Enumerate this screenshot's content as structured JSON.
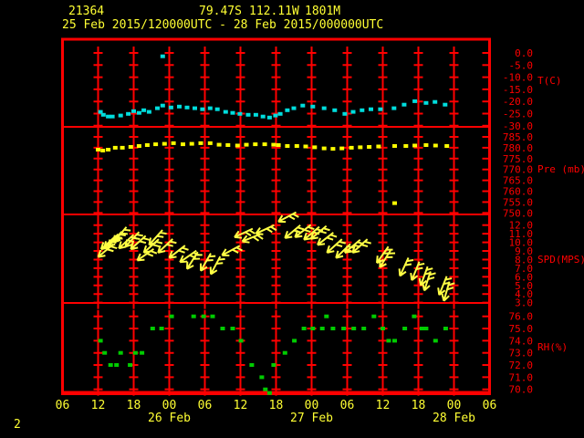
{
  "header": {
    "station_id": "21364",
    "latitude": "79.47S",
    "longitude": "112.11W",
    "elevation": "1801M",
    "period": "25 Feb 2015/120000UTC - 28 Feb 2015/000000UTC"
  },
  "page_indicator": "2",
  "colors": {
    "background": "#000000",
    "frame": "#ff0000",
    "grid": "#ff0000",
    "axis_text": "#ff0000",
    "header_text": "#ffff33",
    "time_text": "#ffff33",
    "temperature": "#00dddd",
    "pressure": "#ffff00",
    "wind": "#ffff44",
    "humidity": "#00cc00"
  },
  "x_axis": {
    "hours_span": 72,
    "label_step_hours": 6,
    "hour_labels": [
      "06",
      "12",
      "18",
      "00",
      "06",
      "12",
      "18",
      "00",
      "06",
      "12",
      "18",
      "00",
      "06"
    ],
    "date_labels": [
      {
        "label": "26 Feb",
        "hour": 18
      },
      {
        "label": "27 Feb",
        "hour": 42
      },
      {
        "label": "28 Feb",
        "hour": 66
      }
    ]
  },
  "chart_data": [
    {
      "type": "scatter",
      "name": "temperature",
      "unit_label": "T(C)",
      "ylim": [
        -30.5,
        5.6
      ],
      "tick_values": [
        0,
        -5,
        -10,
        -15,
        -20,
        -25,
        -30
      ],
      "tick_labels": [
        "0.0",
        "-5.0",
        "-10.0",
        "-15.0",
        "-20.0",
        "-25.0",
        "-30.0"
      ],
      "points": [
        [
          6.4,
          -24.3
        ],
        [
          6.9,
          -25.5
        ],
        [
          7.7,
          -26.2
        ],
        [
          8.4,
          -26.2
        ],
        [
          9.8,
          -25.8
        ],
        [
          11.1,
          -25.1
        ],
        [
          12.0,
          -24.0
        ],
        [
          12.9,
          -24.7
        ],
        [
          13.7,
          -23.6
        ],
        [
          14.6,
          -24.3
        ],
        [
          16.0,
          -22.8
        ],
        [
          16.9,
          -21.7
        ],
        [
          18.3,
          -22.5
        ],
        [
          19.7,
          -22.1
        ],
        [
          21.0,
          -22.5
        ],
        [
          22.3,
          -22.8
        ],
        [
          23.6,
          -23.2
        ],
        [
          24.9,
          -22.8
        ],
        [
          26.1,
          -23.2
        ],
        [
          27.5,
          -24.3
        ],
        [
          28.7,
          -24.7
        ],
        [
          29.9,
          -25.1
        ],
        [
          31.3,
          -25.5
        ],
        [
          32.6,
          -25.5
        ],
        [
          33.8,
          -26.2
        ],
        [
          34.9,
          -26.6
        ],
        [
          35.9,
          -25.8
        ],
        [
          36.7,
          -25.1
        ],
        [
          37.9,
          -23.6
        ],
        [
          39.0,
          -22.8
        ],
        [
          40.5,
          -21.7
        ],
        [
          42.2,
          -22.1
        ],
        [
          44.1,
          -22.8
        ],
        [
          45.9,
          -23.6
        ],
        [
          47.6,
          -25.1
        ],
        [
          49.0,
          -24.3
        ],
        [
          50.5,
          -23.6
        ],
        [
          52.0,
          -23.2
        ],
        [
          53.6,
          -23.2
        ],
        [
          55.9,
          -22.8
        ],
        [
          57.6,
          -21.3
        ],
        [
          59.4,
          -19.9
        ],
        [
          61.3,
          -20.6
        ],
        [
          62.8,
          -20.2
        ],
        [
          64.5,
          -21.3
        ]
      ],
      "outlier_points": [
        [
          16.9,
          -1.4
        ]
      ]
    },
    {
      "type": "scatter",
      "name": "pressure",
      "unit_label": "Pre (mb)",
      "ylim": [
        749.3,
        789.6
      ],
      "tick_values": [
        785,
        780,
        775,
        770,
        765,
        760,
        755,
        750
      ],
      "tick_labels": [
        "785.0",
        "780.0",
        "775.0",
        "770.0",
        "765.0",
        "760.0",
        "755.0",
        "750.0"
      ],
      "points": [
        [
          6.0,
          779.1
        ],
        [
          6.8,
          778.7
        ],
        [
          7.7,
          779.1
        ],
        [
          8.9,
          780.0
        ],
        [
          10.1,
          780.0
        ],
        [
          11.5,
          780.4
        ],
        [
          12.9,
          780.8
        ],
        [
          14.3,
          781.2
        ],
        [
          15.7,
          781.6
        ],
        [
          17.2,
          781.8
        ],
        [
          18.7,
          782.1
        ],
        [
          20.3,
          781.6
        ],
        [
          21.8,
          781.8
        ],
        [
          23.3,
          782.1
        ],
        [
          24.9,
          782.1
        ],
        [
          26.4,
          781.4
        ],
        [
          27.9,
          781.2
        ],
        [
          29.5,
          781.0
        ],
        [
          31.0,
          781.4
        ],
        [
          32.5,
          781.6
        ],
        [
          34.1,
          781.6
        ],
        [
          35.6,
          781.4
        ],
        [
          36.4,
          781.2
        ],
        [
          37.9,
          780.8
        ],
        [
          39.5,
          780.8
        ],
        [
          41.0,
          780.6
        ],
        [
          42.5,
          780.2
        ],
        [
          44.1,
          779.7
        ],
        [
          45.6,
          779.5
        ],
        [
          47.1,
          779.7
        ],
        [
          48.7,
          780.0
        ],
        [
          50.2,
          780.2
        ],
        [
          51.7,
          780.4
        ],
        [
          53.3,
          780.6
        ],
        [
          56.0,
          780.8
        ],
        [
          57.9,
          780.8
        ],
        [
          59.4,
          781.0
        ],
        [
          61.3,
          781.2
        ],
        [
          62.9,
          781.0
        ],
        [
          64.8,
          780.8
        ]
      ],
      "outlier_points": [
        [
          56.0,
          754.5
        ]
      ]
    },
    {
      "type": "arrow-scatter",
      "name": "wind_speed",
      "unit_label": "SPD(MPS)",
      "ylim": [
        2.9,
        13.2
      ],
      "tick_values": [
        12,
        11,
        10,
        9,
        8,
        7,
        6,
        5,
        4,
        3
      ],
      "tick_labels": [
        "12.0",
        "11.0",
        "10.0",
        "9.0",
        "8.0",
        "7.0",
        "6.0",
        "5.0",
        "4.0",
        "3.0"
      ],
      "points": [
        [
          6.0,
          8.3,
          140
        ],
        [
          6.5,
          9.2,
          138
        ],
        [
          7.0,
          9.3,
          135
        ],
        [
          7.7,
          9.5,
          132
        ],
        [
          8.6,
          10.0,
          130
        ],
        [
          9.5,
          9.3,
          137
        ],
        [
          10.6,
          9.5,
          133
        ],
        [
          11.5,
          9.2,
          138
        ],
        [
          12.6,
          7.9,
          145
        ],
        [
          13.7,
          8.8,
          138
        ],
        [
          14.6,
          9.7,
          132
        ],
        [
          16.1,
          8.8,
          137
        ],
        [
          18.0,
          8.2,
          142
        ],
        [
          19.8,
          7.7,
          145
        ],
        [
          21.0,
          6.9,
          122
        ],
        [
          23.3,
          6.7,
          120
        ],
        [
          25.0,
          6.3,
          118
        ],
        [
          26.9,
          8.5,
          152
        ],
        [
          29.0,
          10.6,
          155
        ],
        [
          30.3,
          10.1,
          158
        ],
        [
          32.6,
          11.0,
          155
        ],
        [
          36.4,
          12.4,
          152
        ],
        [
          37.5,
          10.5,
          140
        ],
        [
          39.2,
          10.6,
          142
        ],
        [
          40.7,
          10.3,
          140
        ],
        [
          41.9,
          10.4,
          140
        ],
        [
          43.0,
          9.7,
          142
        ],
        [
          44.6,
          8.8,
          138
        ],
        [
          46.1,
          8.2,
          136
        ],
        [
          47.6,
          8.8,
          140
        ],
        [
          48.9,
          8.8,
          138
        ],
        [
          53.0,
          7.6,
          125
        ],
        [
          53.5,
          7.1,
          122
        ],
        [
          56.9,
          6.1,
          115
        ],
        [
          58.9,
          5.6,
          112
        ],
        [
          60.4,
          5.0,
          110
        ],
        [
          61.0,
          4.4,
          108
        ],
        [
          63.5,
          3.9,
          112
        ],
        [
          64.3,
          3.2,
          106
        ]
      ]
    },
    {
      "type": "scatter",
      "name": "relative_humidity",
      "unit_label": "RH(%)",
      "ylim": [
        69.7,
        77.1
      ],
      "tick_values": [
        76,
        75,
        74,
        73,
        72,
        71,
        70
      ],
      "tick_labels": [
        "76.0",
        "75.0",
        "74.0",
        "73.0",
        "72.0",
        "71.0",
        "70.0"
      ],
      "points": [
        [
          6.4,
          74
        ],
        [
          7.1,
          73
        ],
        [
          8.1,
          72
        ],
        [
          9.1,
          72
        ],
        [
          9.8,
          73
        ],
        [
          11.4,
          72
        ],
        [
          12.3,
          73
        ],
        [
          13.4,
          73
        ],
        [
          15.2,
          75
        ],
        [
          16.7,
          75
        ],
        [
          18.4,
          76
        ],
        [
          22.1,
          76
        ],
        [
          23.8,
          76
        ],
        [
          25.3,
          76
        ],
        [
          27.0,
          75
        ],
        [
          28.7,
          75
        ],
        [
          30.1,
          74
        ],
        [
          31.9,
          72
        ],
        [
          33.6,
          71
        ],
        [
          34.2,
          70
        ],
        [
          34.9,
          69.7
        ],
        [
          35.6,
          72
        ],
        [
          37.5,
          73
        ],
        [
          39.1,
          74
        ],
        [
          40.7,
          75
        ],
        [
          42.2,
          75
        ],
        [
          43.8,
          75
        ],
        [
          44.5,
          76
        ],
        [
          45.6,
          75
        ],
        [
          47.4,
          75
        ],
        [
          49.1,
          75
        ],
        [
          50.8,
          75
        ],
        [
          52.5,
          76
        ],
        [
          54.0,
          75
        ],
        [
          55.0,
          74
        ],
        [
          56.0,
          74
        ],
        [
          57.7,
          75
        ],
        [
          59.3,
          76
        ],
        [
          60.6,
          75
        ],
        [
          61.3,
          75
        ],
        [
          62.9,
          74
        ],
        [
          64.6,
          75
        ]
      ]
    }
  ]
}
